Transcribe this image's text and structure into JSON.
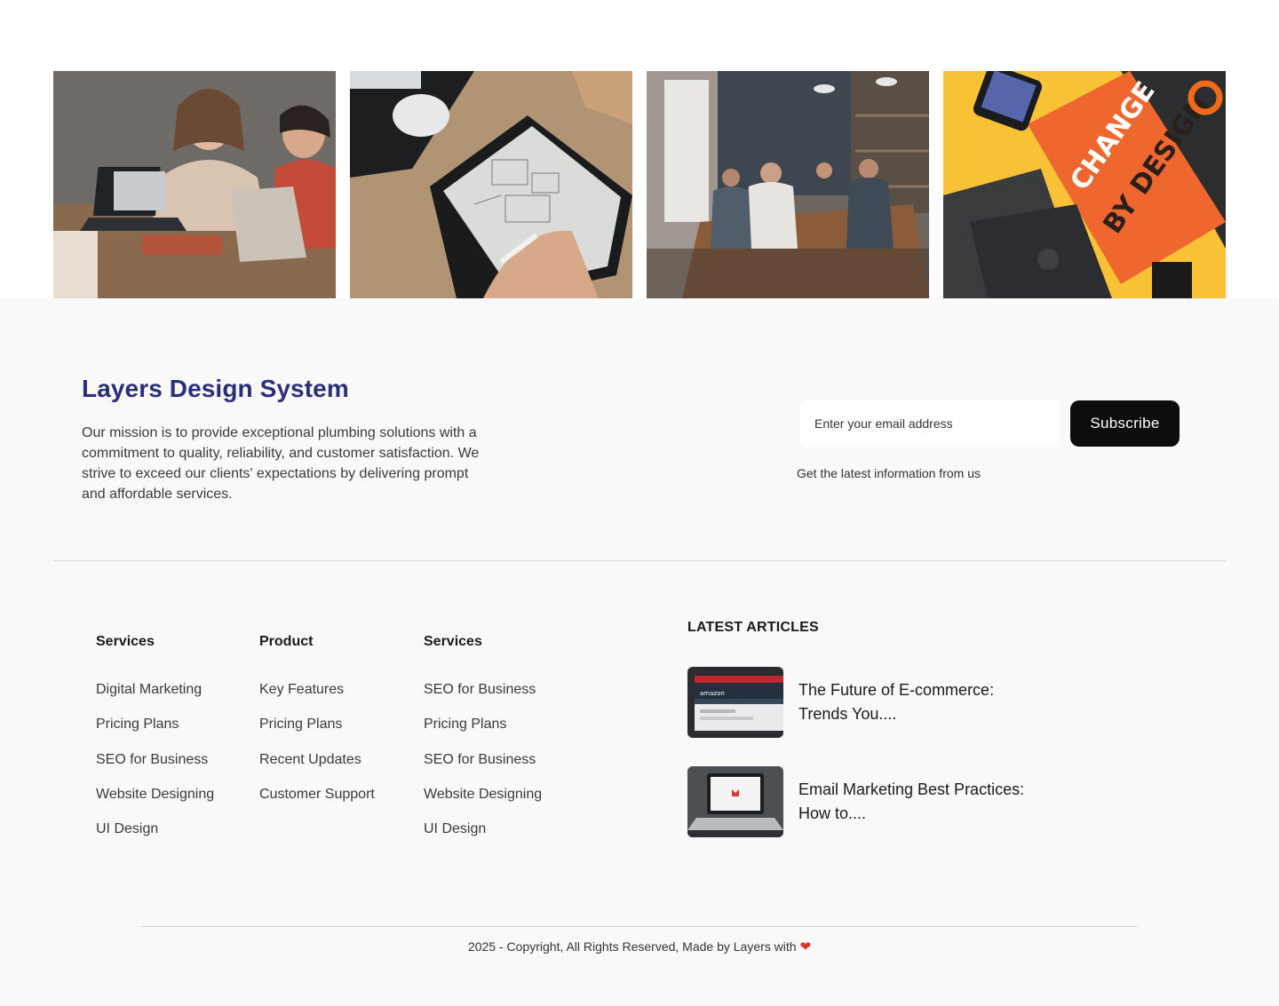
{
  "gallery": {
    "images": [
      {
        "alt": "people-laptops-photo"
      },
      {
        "alt": "tablet-wireframe-photo"
      },
      {
        "alt": "office-meeting-photo"
      },
      {
        "alt": "change-by-design-book-photo"
      }
    ]
  },
  "brand": {
    "title": "Layers Design System",
    "mission": "Our mission is to provide exceptional plumbing solutions with a commitment to quality, reliability, and customer satisfaction. We strive to exceed our clients' expectations by delivering prompt and affordable services."
  },
  "newsletter": {
    "placeholder": "Enter your email address",
    "button_label": "Subscribe",
    "note": "Get the latest information from us"
  },
  "columns": [
    {
      "heading": "Services",
      "items": [
        "Digital Marketing",
        "Pricing Plans",
        "SEO for Business",
        "Website Designing",
        "UI Design"
      ]
    },
    {
      "heading": "Product",
      "items": [
        "Key Features",
        "Pricing Plans",
        "Recent Updates",
        "Customer Support"
      ]
    },
    {
      "heading": "Services",
      "items": [
        "SEO for Business",
        "Pricing Plans",
        "SEO for Business",
        "Website Designing",
        "UI Design"
      ]
    }
  ],
  "articles": {
    "heading": "LATEST ARTICLES",
    "items": [
      {
        "title": "The Future of E-commerce: Trends You...."
      },
      {
        "title": "Email Marketing Best Practices: How to...."
      }
    ]
  },
  "footer": {
    "copyright": "2025 - Copyright, All Rights Reserved, Made by Layers with",
    "heart_icon": "heart-icon"
  },
  "colors": {
    "brand_title": "#2b2f7a",
    "button_bg": "#0d0d0d",
    "footer_bg": "#f9f9f9",
    "heart": "#d9342b"
  }
}
